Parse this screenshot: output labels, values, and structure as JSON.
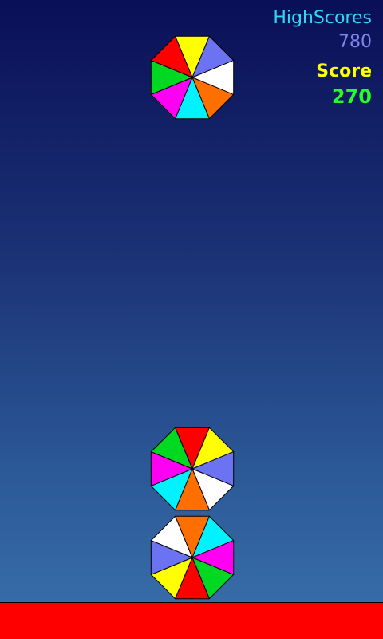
{
  "hud": {
    "highscores_label": "HighScores",
    "highscores_value": "780",
    "score_label": "Score",
    "score_value": "270"
  },
  "colors": {
    "background_top": "#0a0f57",
    "background_bottom": "#3a71ab",
    "highscores_label": "#33d7f2",
    "highscores_value": "#7f86ee",
    "score_label": "#ffff00",
    "score_value": "#22ff22",
    "ground": "#ff0000",
    "segment_red": "#ff0000",
    "segment_yellow": "#ffff00",
    "segment_blue": "#6b73f2",
    "segment_white": "#ffffff",
    "segment_orange": "#ff6f00",
    "segment_cyan": "#00f2ff",
    "segment_magenta": "#ff00f2",
    "segment_green": "#00d822"
  },
  "pieces": [
    {
      "name": "falling-octagon-piece",
      "segments": [
        "yellow",
        "blue",
        "white",
        "orange",
        "cyan",
        "magenta",
        "green",
        "red"
      ]
    },
    {
      "name": "stacked-octagon-upper",
      "segments": [
        "red",
        "yellow",
        "blue",
        "white",
        "orange",
        "cyan",
        "magenta",
        "green"
      ]
    },
    {
      "name": "stacked-octagon-lower",
      "segments": [
        "orange",
        "cyan",
        "magenta",
        "green",
        "red",
        "yellow",
        "blue",
        "white"
      ]
    }
  ]
}
